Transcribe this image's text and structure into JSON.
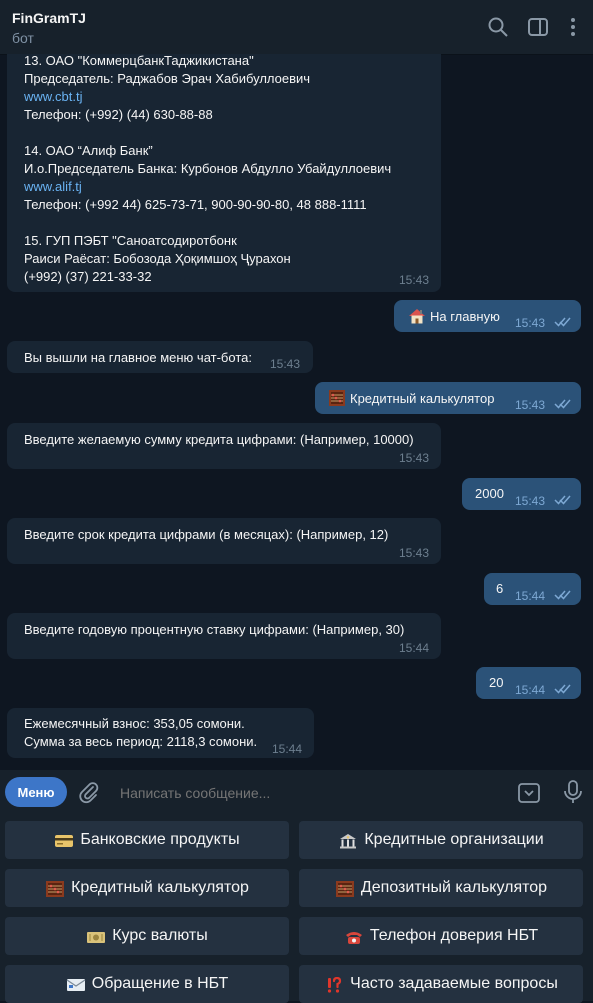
{
  "header": {
    "title": "FinGramTJ",
    "subtitle": "бот"
  },
  "messages": [
    {
      "dir": "in",
      "lines": [
        "13. ОАО \"КоммерцбанкТаджикистана\"",
        "Председатель: Раджабов Эрач Хабибуллоевич",
        "www.cbt.tj",
        "Телефон: (+992) (44) 630-88-88",
        "",
        "14. ОАО “Алиф Банк”",
        "И.о.Председатель Банка: Курбонов Абдулло Убайдуллоевич",
        "www.alif.tj",
        "Телефон: (+992 44) 625-73-71, 900-90-90-80, 48 888-1111",
        "",
        "15. ГУП ПЭБТ \"Саноатсодиротбонк",
        "Раиси Раёсат: Бобозода Ҳоқимшоҳ Ҷурахон",
        "(+992) (37) 221-33-32"
      ],
      "time": "15:43"
    },
    {
      "dir": "out",
      "emoji": "house",
      "text": "На главную",
      "time": "15:43"
    },
    {
      "dir": "in",
      "text": "Вы вышли на главное меню чат-бота:",
      "time": "15:43"
    },
    {
      "dir": "out",
      "emoji": "abacus",
      "text": "Кредитный калькулятор",
      "time": "15:43"
    },
    {
      "dir": "in",
      "text": "Введите желаемую сумму кредита цифрами: (Например, 10000)",
      "time": "15:43"
    },
    {
      "dir": "out",
      "text": "2000",
      "time": "15:43"
    },
    {
      "dir": "in",
      "text": "Введите срок кредита цифрами (в месяцах): (Например, 12)",
      "time": "15:43"
    },
    {
      "dir": "out",
      "text": "6",
      "time": "15:44"
    },
    {
      "dir": "in",
      "text": "Введите годовую процентную ставку цифрами: (Например, 30)",
      "time": "15:44"
    },
    {
      "dir": "out",
      "text": "20",
      "time": "15:44"
    },
    {
      "dir": "in",
      "lines": [
        "Ежемесячный взнос: 353,05 сомони.",
        "Сумма за весь период: 2118,3 сомони."
      ],
      "time": "15:44"
    }
  ],
  "composer": {
    "menu_label": "Меню",
    "placeholder": "Написать сообщение..."
  },
  "keyboard": [
    {
      "icon": "credit-card",
      "label": "Банковские продукты"
    },
    {
      "icon": "bank",
      "label": "Кредитные организации"
    },
    {
      "icon": "abacus",
      "label": "Кредитный калькулятор"
    },
    {
      "icon": "abacus",
      "label": "Депозитный калькулятор"
    },
    {
      "icon": "money",
      "label": "Курс валюты"
    },
    {
      "icon": "telephone",
      "label": "Телефон доверия НБТ"
    },
    {
      "icon": "envelope",
      "label": "Обращение в НБТ"
    },
    {
      "icon": "exclamation-question",
      "label": "Часто задаваемые вопросы"
    }
  ],
  "colors": {
    "background": "#0e1621",
    "header": "#17212b",
    "incoming_bubble": "#182533",
    "outgoing_bubble": "#2b5278",
    "link": "#6ab3f3",
    "menu_button": "#3d76c8",
    "keyboard_button": "#243140"
  }
}
